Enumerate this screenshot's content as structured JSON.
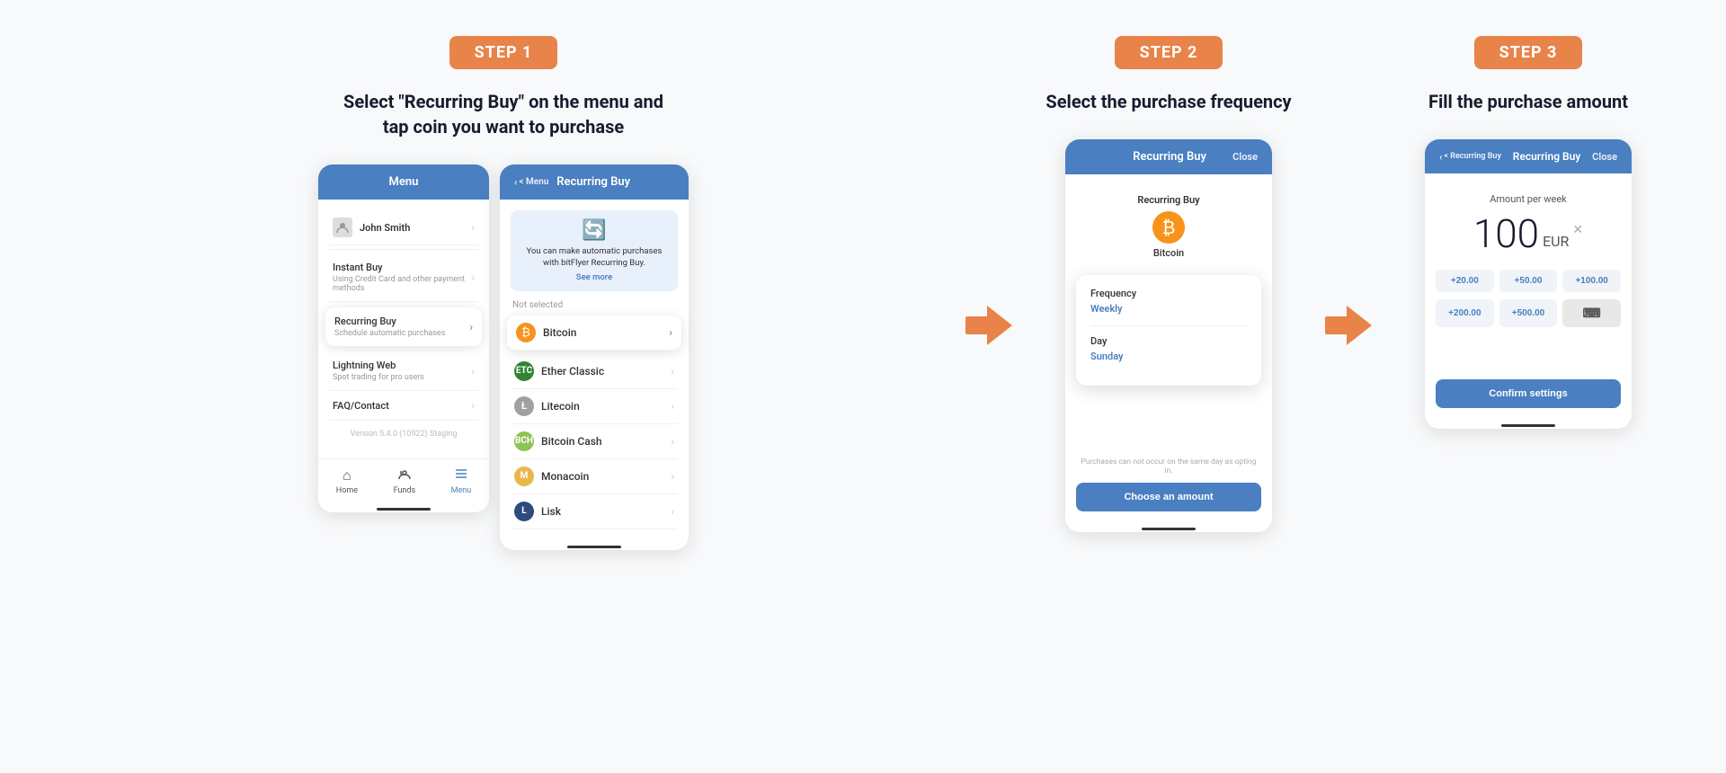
{
  "steps": [
    {
      "badge": "STEP 1",
      "heading": "Select \"Recurring Buy\" on the menu and tap coin you want to purchase"
    },
    {
      "badge": "STEP 2",
      "heading": "Select the purchase frequency"
    },
    {
      "badge": "STEP 3",
      "heading": "Fill the purchase amount"
    }
  ],
  "screen1_menu": {
    "title": "Menu",
    "user": "John Smith",
    "items": [
      {
        "label": "Instant Buy",
        "sub": "Using Credit Card and other payment methods"
      },
      {
        "label": "Recurring Buy",
        "sub": "Schedule automatic purchases",
        "highlighted": true
      },
      {
        "label": "Lightning Web",
        "sub": "Spot trading for pro users"
      },
      {
        "label": "FAQ/Contact",
        "sub": ""
      }
    ],
    "version": "Version 5.4.0 (10922) Staging",
    "nav": [
      "Home",
      "Funds",
      "Menu"
    ]
  },
  "screen2_coins": {
    "header_back": "< Menu",
    "header_title": "Recurring Buy",
    "promo_text": "You can make automatic purchases with bitFlyer Recurring Buy.",
    "promo_link": "See more",
    "not_selected": "Not selected",
    "coins": [
      {
        "name": "Bitcoin",
        "type": "btc",
        "selected": true
      },
      {
        "name": "Ether Classic",
        "type": "etc"
      },
      {
        "name": "Litecoin",
        "type": "ltc"
      },
      {
        "name": "Bitcoin Cash",
        "type": "bch"
      },
      {
        "name": "Monacoin",
        "type": "mona"
      },
      {
        "name": "Lisk",
        "type": "lisk"
      }
    ]
  },
  "screen3_freq": {
    "header_title": "Recurring Buy",
    "header_close": "Close",
    "coin_name": "Bitcoin",
    "frequency_label": "Frequency",
    "frequency_value": "Weekly",
    "day_label": "Day",
    "day_value": "Sunday",
    "purchase_note": "Purchases can not occur on the same day as opting in.",
    "btn_label": "Choose an amount"
  },
  "screen4_amount": {
    "header_back": "< Recurring Buy",
    "header_title": "Recurring Buy",
    "header_close": "Close",
    "amount_label": "Amount per week",
    "amount_number": "100",
    "amount_currency": "EUR",
    "presets": [
      "+20.00",
      "+50.00",
      "+100.00",
      "+200.00",
      "+500.00"
    ],
    "btn_label": "Confirm settings"
  }
}
